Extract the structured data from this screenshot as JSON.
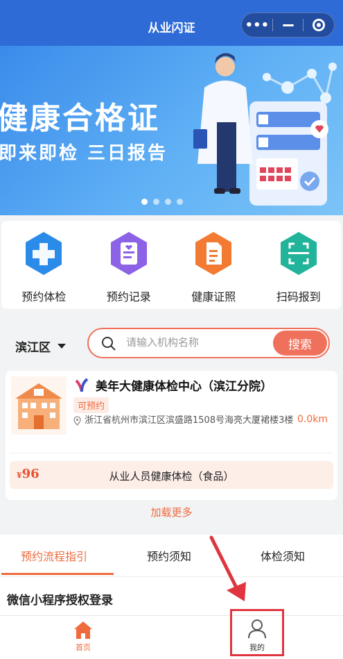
{
  "header": {
    "title": "从业闪证",
    "more_icon": "more-dots-icon",
    "minimize_icon": "minimize-icon",
    "close_icon": "target-circle-icon"
  },
  "banner": {
    "title": "健康合格证",
    "subtitle": "即来即检 三日报告",
    "slides": 4,
    "active_slide": 0
  },
  "actions": [
    {
      "label": "预约体检",
      "icon": "medical-cross-icon",
      "color": "#2b8be8"
    },
    {
      "label": "预约记录",
      "icon": "record-document-icon",
      "color": "#8c62e6"
    },
    {
      "label": "健康证照",
      "icon": "certificate-icon",
      "color": "#f27a32"
    },
    {
      "label": "扫码报到",
      "icon": "scan-code-icon",
      "color": "#22b49a"
    }
  ],
  "search": {
    "district": "滨江区",
    "placeholder": "请输入机构名称",
    "button": "搜索"
  },
  "institution": {
    "name": "美年大健康体检中心（滨江分院）",
    "status": "可预约",
    "address": "浙江省杭州市滨江区滨盛路1508号海亮大厦裙楼3楼",
    "distance": "0.0km",
    "price_symbol": "¥",
    "price": "96",
    "package": "从业人员健康体检（食品）"
  },
  "load_more": "加载更多",
  "tabs": [
    {
      "label": "预约流程指引",
      "active": true
    },
    {
      "label": "预约须知",
      "active": false
    },
    {
      "label": "体检须知",
      "active": false
    }
  ],
  "section_title": "微信小程序授权登录",
  "bottom_nav": {
    "home": "首页",
    "mine": "我的"
  },
  "colors": {
    "primary_blue": "#2e6bd6",
    "accent_orange": "#ef6a3c",
    "highlight_red": "#e0353f"
  }
}
